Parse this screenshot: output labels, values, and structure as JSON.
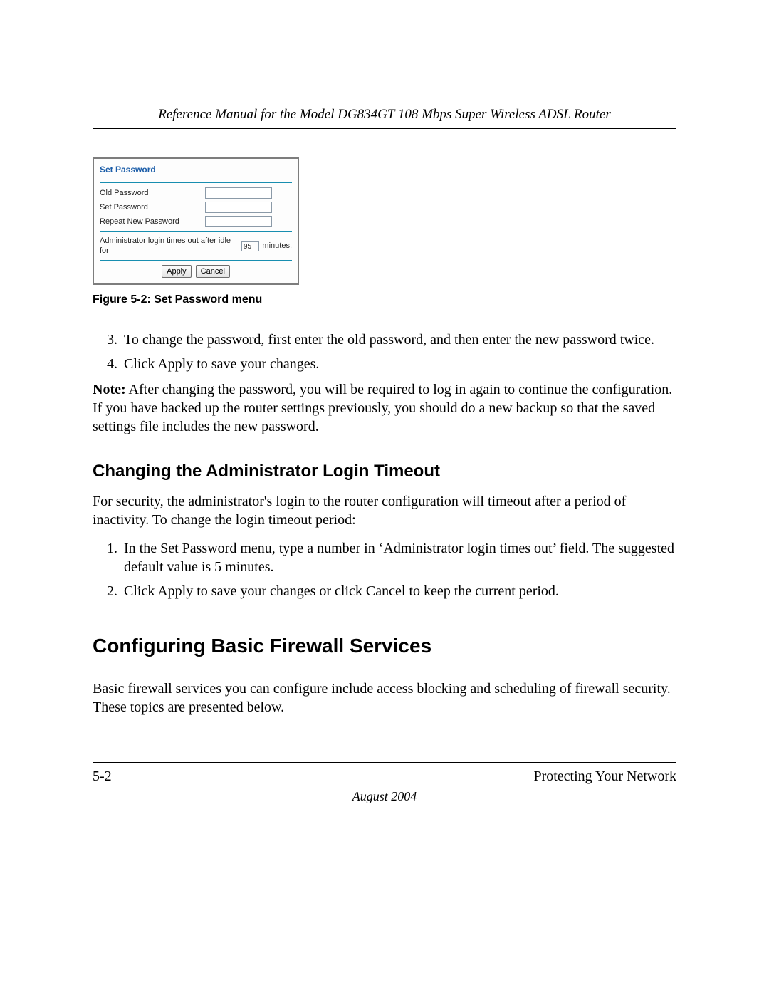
{
  "header": {
    "running_title": "Reference Manual for the Model DG834GT 108 Mbps Super Wireless ADSL Router"
  },
  "figure": {
    "panel_title": "Set Password",
    "rows": {
      "old_label": "Old Password",
      "set_label": "Set Password",
      "repeat_label": "Repeat New Password"
    },
    "idle_before": "Administrator login times out after idle for",
    "idle_value": "95",
    "idle_after": "minutes.",
    "apply": "Apply",
    "cancel": "Cancel",
    "caption": "Figure 5-2:  Set Password menu"
  },
  "steps_a": {
    "start": 3,
    "items": [
      "To change the password, first enter the old password, and then enter the new password twice.",
      "Click Apply to save your changes."
    ]
  },
  "note": {
    "label": "Note:",
    "text": " After changing the password, you will be required to log in again to continue the configuration. If you have backed up the router settings previously, you should do a new backup so that the saved settings file includes the new password."
  },
  "subheading": "Changing the Administrator Login Timeout",
  "sub_intro": "For security, the administrator's login to the router configuration will timeout after a period of inactivity. To change the login timeout period:",
  "steps_b": {
    "start": 1,
    "items": [
      "In the Set Password menu, type a number in ‘Administrator login times out’ field. The suggested default value is 5 minutes.",
      "Click Apply to save your changes or click Cancel to keep the current period."
    ]
  },
  "section_heading": "Configuring Basic Firewall Services",
  "section_intro": "Basic firewall services you can configure include access blocking and scheduling of firewall security. These topics are presented below.",
  "footer": {
    "page": "5-2",
    "chapter": "Protecting Your Network",
    "date": "August 2004"
  }
}
